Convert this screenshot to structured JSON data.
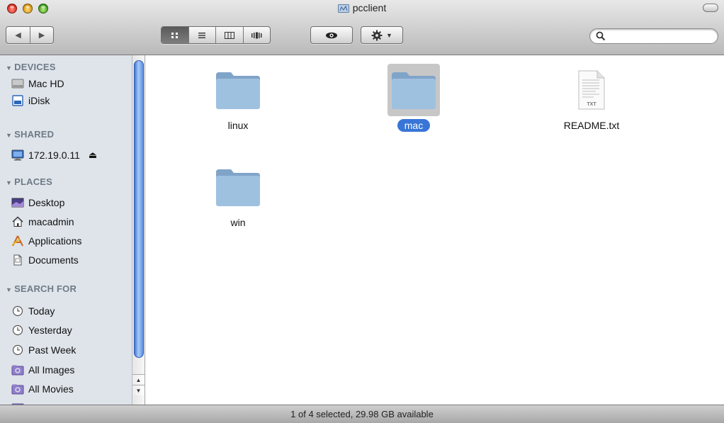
{
  "window": {
    "title": "pcclient"
  },
  "toolbar": {
    "search": {
      "placeholder": "",
      "value": ""
    }
  },
  "sidebar": {
    "sections": [
      {
        "heading": "DEVICES",
        "items": [
          {
            "label": "Mac HD",
            "icon": "harddisk-icon"
          },
          {
            "label": "iDisk",
            "icon": "idisk-icon"
          }
        ]
      },
      {
        "heading": "SHARED",
        "items": [
          {
            "label": "172.19.0.11",
            "icon": "network-computer-icon"
          }
        ]
      },
      {
        "heading": "PLACES",
        "items": [
          {
            "label": "Desktop",
            "icon": "desktop-icon"
          },
          {
            "label": "macadmin",
            "icon": "home-icon"
          },
          {
            "label": "Applications",
            "icon": "applications-icon"
          },
          {
            "label": "Documents",
            "icon": "documents-icon"
          }
        ]
      },
      {
        "heading": "SEARCH FOR",
        "items": [
          {
            "label": "Today",
            "icon": "clock-icon"
          },
          {
            "label": "Yesterday",
            "icon": "clock-icon"
          },
          {
            "label": "Past Week",
            "icon": "clock-icon"
          },
          {
            "label": "All Images",
            "icon": "smart-folder-icon"
          },
          {
            "label": "All Movies",
            "icon": "smart-folder-icon"
          }
        ]
      }
    ]
  },
  "files": [
    {
      "name": "linux",
      "type": "folder",
      "selected": false
    },
    {
      "name": "mac",
      "type": "folder",
      "selected": true
    },
    {
      "name": "README.txt",
      "type": "text",
      "badge": "TXT",
      "selected": false
    },
    {
      "name": "win",
      "type": "folder",
      "selected": false
    }
  ],
  "status": {
    "text": "1 of 4 selected, 29.98 GB available"
  },
  "colors": {
    "selection": "#3875d7",
    "sidebar_bg": "#dee4ea",
    "heading": "#6f7a86"
  }
}
